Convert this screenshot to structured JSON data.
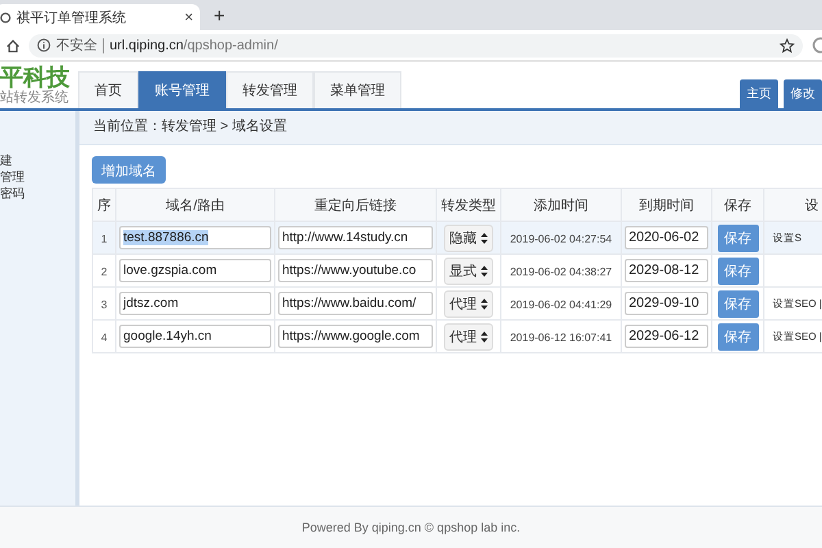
{
  "browser": {
    "tab_title": "祺平订单管理系统",
    "close": "×",
    "new_tab": "+",
    "security": "不安全",
    "url_host": "url.qiping.cn",
    "url_path": "/qpshop-admin/"
  },
  "header": {
    "logo": "平科技",
    "subtitle": "站转发系统",
    "nav": [
      {
        "label": "首页",
        "selected": false
      },
      {
        "label": "账号管理",
        "selected": true
      },
      {
        "label": "转发管理",
        "selected": false
      },
      {
        "label": "菜单管理",
        "selected": false
      }
    ],
    "right_buttons": [
      "主页",
      "修改"
    ]
  },
  "sidebar": {
    "items": [
      "建",
      "管理",
      "密码"
    ]
  },
  "breadcrumb": "当前位置：转发管理 > 域名设置",
  "add_button": "增加域名",
  "table": {
    "columns": [
      "序",
      "域名/路由",
      "重定向后链接",
      "转发类型",
      "添加时间",
      "到期时间",
      "保存",
      "设"
    ],
    "rows": [
      {
        "index": "1",
        "domain": "test.887886.cn",
        "domain_selected": true,
        "selected": true,
        "link": "http://www.14study.cn",
        "type": "隐藏",
        "added": "2019-06-02 04:27:54",
        "expires": "2020-06-02",
        "save": "保存",
        "settings": "设置S"
      },
      {
        "index": "2",
        "domain": "love.gzspia.com",
        "domain_selected": false,
        "selected": false,
        "link": "https://www.youtube.co",
        "type": "显式",
        "added": "2019-06-02 04:38:27",
        "expires": "2029-08-12",
        "save": "保存"
      },
      {
        "index": "3",
        "domain": "jdtsz.com",
        "domain_selected": false,
        "selected": false,
        "link": "https://www.baidu.com/",
        "type": "代理",
        "added": "2019-06-02 04:41:29",
        "expires": "2029-09-10",
        "save": "保存",
        "settings": "设置SEO |"
      },
      {
        "index": "4",
        "domain": "google.14yh.cn",
        "domain_selected": false,
        "selected": false,
        "link": "https://www.google.com",
        "type": "代理",
        "added": "2019-06-12 16:07:41",
        "expires": "2029-06-12",
        "save": "保存",
        "settings": "设置SEO |"
      }
    ]
  },
  "footer": "Powered By qiping.cn © qpshop lab inc."
}
